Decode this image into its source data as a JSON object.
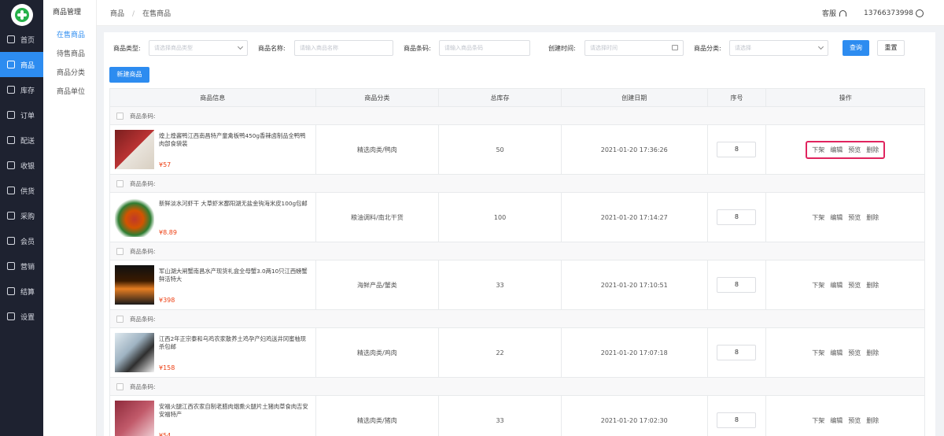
{
  "nav": {
    "items": [
      {
        "label": "首页",
        "icon": "home-icon"
      },
      {
        "label": "商品",
        "icon": "goods-icon",
        "active": true
      },
      {
        "label": "库存",
        "icon": "inventory-icon"
      },
      {
        "label": "订单",
        "icon": "order-icon"
      },
      {
        "label": "配送",
        "icon": "truck-icon"
      },
      {
        "label": "收银",
        "icon": "cashier-icon"
      },
      {
        "label": "供货",
        "icon": "supply-icon"
      },
      {
        "label": "采购",
        "icon": "cart-icon"
      },
      {
        "label": "会员",
        "icon": "member-icon"
      },
      {
        "label": "营销",
        "icon": "tag-icon"
      },
      {
        "label": "结算",
        "icon": "settle-icon"
      },
      {
        "label": "设置",
        "icon": "gear-icon"
      }
    ],
    "accent": "#2d8cf0"
  },
  "submenu": {
    "title": "商品管理",
    "items": [
      "在售商品",
      "待售商品",
      "商品分类",
      "商品单位"
    ]
  },
  "breadcrumb": {
    "root": "商品",
    "sep": "/",
    "current": "在售商品"
  },
  "header": {
    "service": "客服",
    "phone": "13766373998"
  },
  "filters": {
    "type_label": "商品类型:",
    "type_placeholder": "请选择商品类型",
    "name_label": "商品名称:",
    "name_placeholder": "请输入商品名称",
    "barcode_label": "商品条码:",
    "barcode_placeholder": "请输入商品条码",
    "time_label": "创建时间:",
    "time_placeholder": "请选择时间",
    "category_label": "商品分类:",
    "category_placeholder": "请选择",
    "search_label": "查询",
    "reset_label": "重置"
  },
  "new_button": "新建商品",
  "table": {
    "headers": [
      "商品信息",
      "商品分类",
      "总库存",
      "创建日期",
      "序号",
      "操作"
    ],
    "barcode_label": "商品条码:",
    "actions": [
      "下架",
      "编辑",
      "预览",
      "删除"
    ],
    "rows": [
      {
        "name": "煌上煌酱鸭江西南昌特产童禽板鸭450g香辣卤制品全鸭鸭肉部食袋装",
        "price": "¥57",
        "category": "精选肉类/鸭肉",
        "stock": "50",
        "date": "2021-01-20 17:36:26",
        "seq": "8",
        "highlight": true
      },
      {
        "name": "新鲜淡水河虾干 大草虾米鄱阳湖无盐金钩海米皮100g包邮",
        "price": "¥8.89",
        "category": "粮油调料/南北干货",
        "stock": "100",
        "date": "2021-01-20 17:14:27",
        "seq": "8",
        "highlight": false
      },
      {
        "name": "军山湖大闸蟹南昌水产现货礼盒全母蟹3.0两10只江西螃蟹鲜活特大",
        "price": "¥398",
        "category": "海鲜产品/蟹类",
        "stock": "33",
        "date": "2021-01-20 17:10:51",
        "seq": "8",
        "highlight": false
      },
      {
        "name": "江西2年正宗泰和乌鸡农家散养土鸡孕产妇鸡送井冈蜜柚现杀包邮",
        "price": "¥158",
        "category": "精选肉类/鸡肉",
        "stock": "22",
        "date": "2021-01-20 17:07:18",
        "seq": "8",
        "highlight": false
      },
      {
        "name": "安福火腿江西农家自制老腊肉烟熏火腿片土猪肉草食肉吉安安福特产",
        "price": "¥54",
        "category": "精选肉类/猪肉",
        "stock": "33",
        "date": "2021-01-20 17:02:30",
        "seq": "8",
        "highlight": false
      }
    ]
  }
}
